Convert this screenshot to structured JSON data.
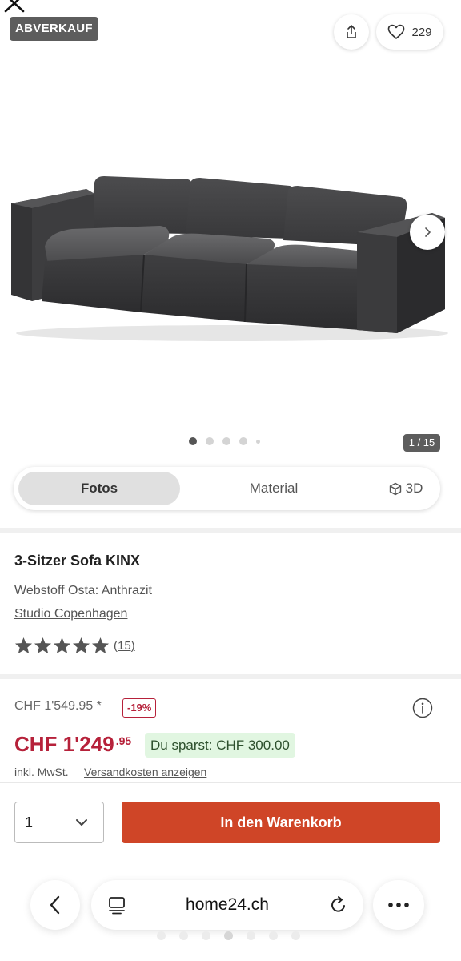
{
  "gallery": {
    "badge": "ABVERKAUF",
    "favorite_count": "229",
    "image_counter": "1 / 15",
    "product_image": "sofa-photo",
    "dots_total": 5,
    "dot_active_index": 0
  },
  "media_tabs": {
    "fotos": "Fotos",
    "material": "Material",
    "three_d": "3D"
  },
  "product": {
    "title": "3-Sitzer Sofa KINX",
    "variant": "Webstoff Osta: Anthrazit",
    "brand": "Studio Copenhagen",
    "rating_stars": 5,
    "review_count": "(15)"
  },
  "price": {
    "old_price": "CHF 1'549.95",
    "old_price_marker": "*",
    "discount": "-19%",
    "current_main": "CHF 1'249",
    "current_cents": ".95",
    "savings": "Du sparst: CHF 300.00",
    "vat_note": "inkl. MwSt.",
    "shipping_link": "Versandkosten anzeigen"
  },
  "buy": {
    "quantity": "1",
    "add_to_cart": "In den Warenkorb"
  },
  "browser": {
    "url": "home24.ch",
    "tab_dots": 7,
    "tab_dot_active_index": 3
  },
  "colors": {
    "accent_red": "#b6213a",
    "cart_orange": "#cf4527",
    "savings_green_bg": "#e1f6e1",
    "badge_gray": "#5d5d5d"
  },
  "icons": [
    "close-icon",
    "share-icon",
    "heart-icon",
    "chevron-right-icon",
    "cube-3d-icon",
    "star-icon",
    "info-icon",
    "chevron-down-icon",
    "back-icon",
    "tabs-icon",
    "reload-icon",
    "more-icon"
  ]
}
